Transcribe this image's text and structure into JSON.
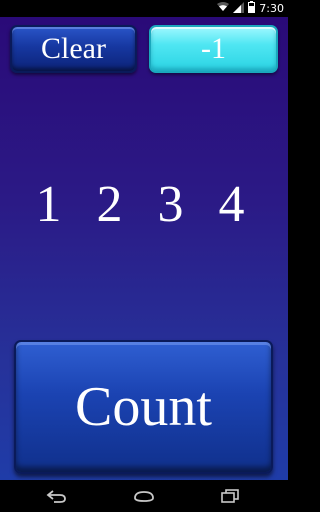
{
  "status_bar": {
    "time": "7:30",
    "icons": [
      "wifi-icon",
      "signal-icon",
      "battery-icon"
    ]
  },
  "controls": {
    "clear_label": "Clear",
    "value_display": "-1"
  },
  "sequence": "1 2 3 4",
  "count_label": "Count",
  "nav_bar": {
    "icons": [
      "back-icon",
      "home-icon",
      "recents-icon"
    ]
  },
  "colors": {
    "background_top": "#2a0a78",
    "background_bottom": "#1f3ca8",
    "button_blue": "#1637a0",
    "display_cyan": "#4fe6f2"
  }
}
